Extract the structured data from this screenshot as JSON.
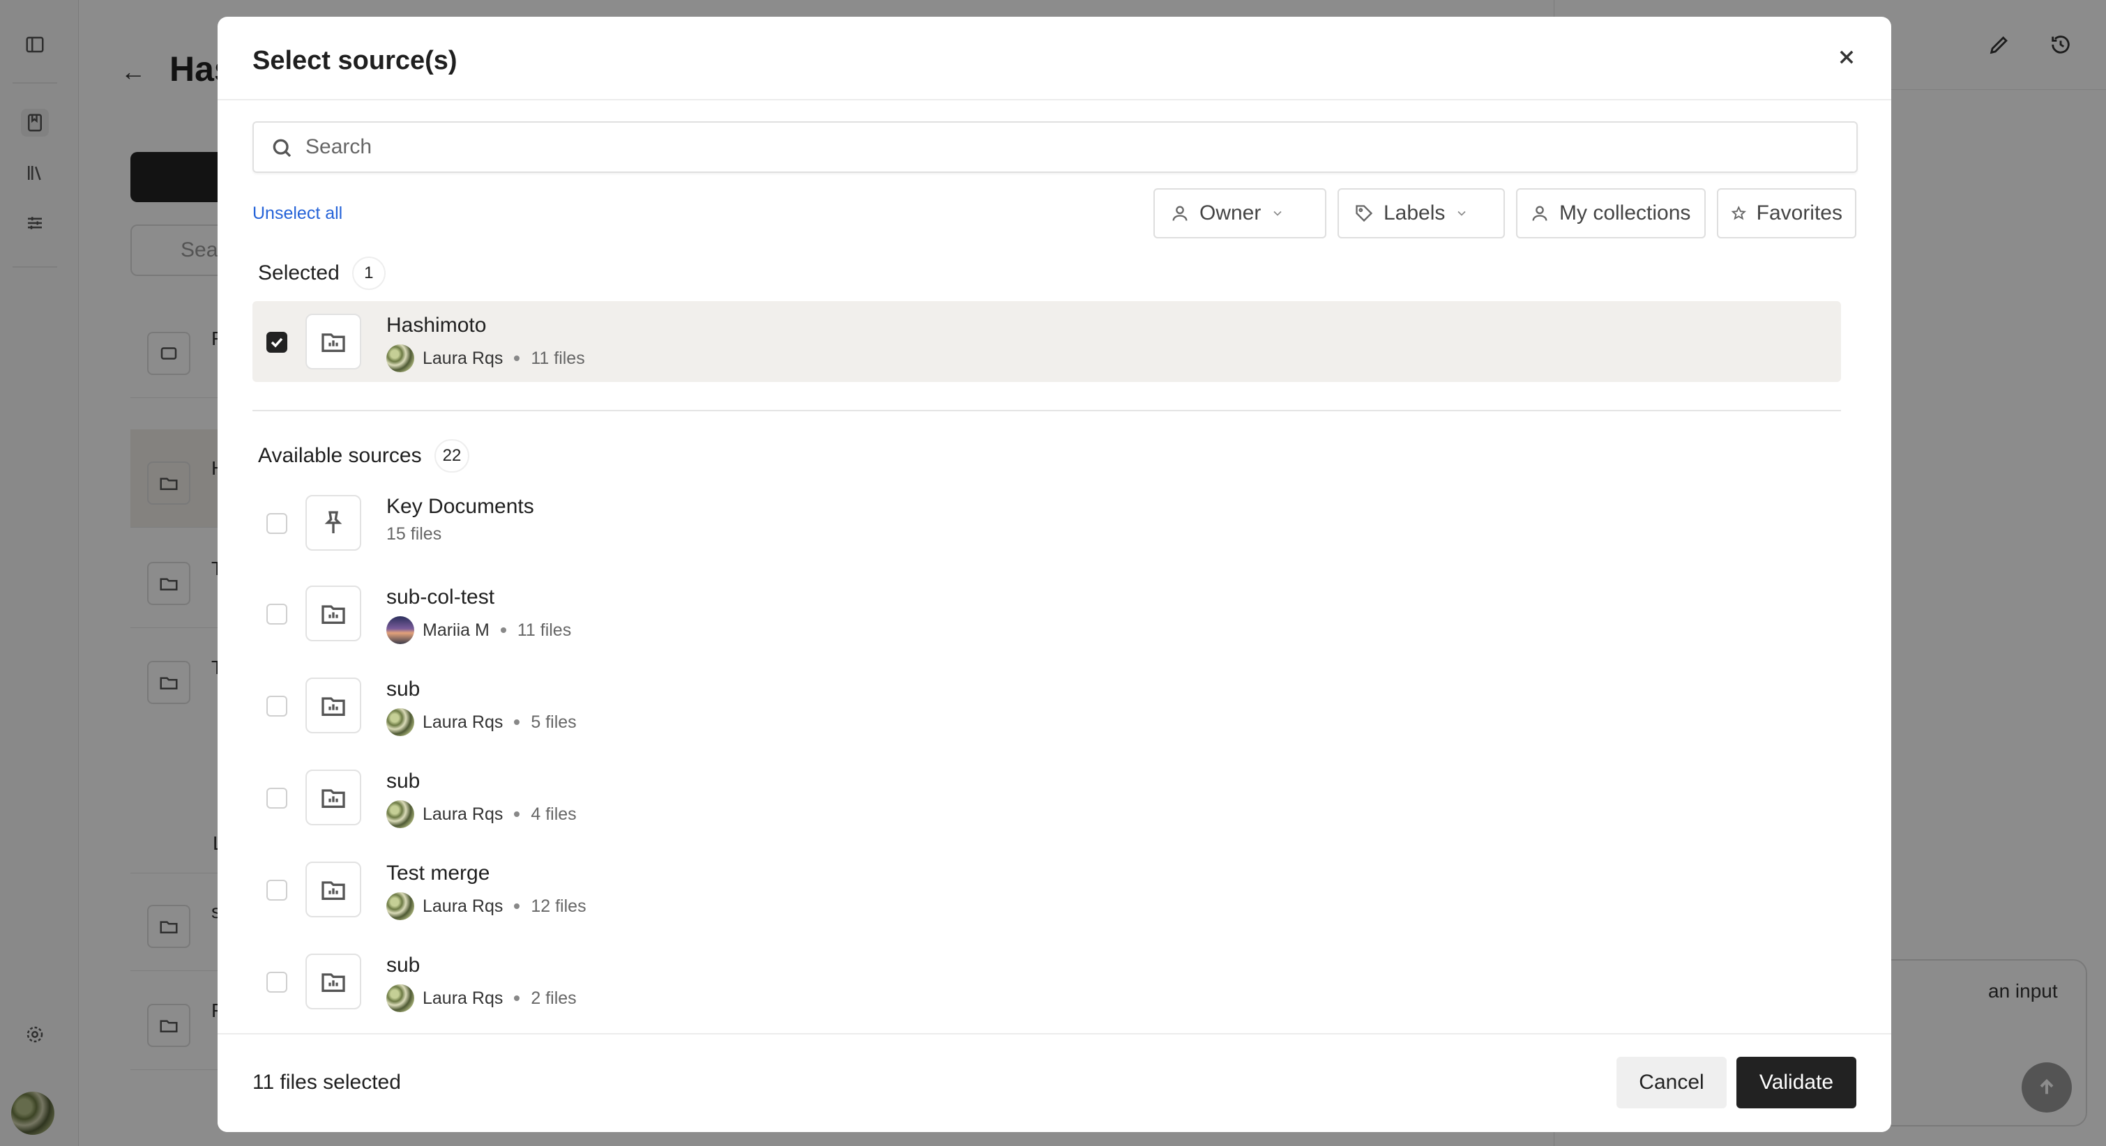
{
  "background": {
    "page_title": "Has",
    "search_placeholder": "Sea",
    "rows": [
      "F",
      "H",
      "T",
      "T",
      "s",
      "F"
    ],
    "row_sub": "L",
    "chat_input_text": "an input"
  },
  "modal": {
    "title": "Select source(s)",
    "search_placeholder": "Search",
    "unselect_all": "Unselect all",
    "filters": {
      "owner": "Owner",
      "labels": "Labels",
      "my_collections": "My collections",
      "favorites": "Favorites"
    },
    "selected": {
      "label": "Selected",
      "count": "1",
      "items": [
        {
          "name": "Hashimoto",
          "owner": "Laura Rqs",
          "files": "11 files",
          "icon": "folder-chart-icon",
          "checked": true
        }
      ]
    },
    "available": {
      "label": "Available sources",
      "count": "22",
      "items": [
        {
          "name": "Key Documents",
          "owner": "",
          "files": "15 files",
          "icon": "pin-icon",
          "checked": false
        },
        {
          "name": "sub-col-test",
          "owner": "Mariia M",
          "files": "11 files",
          "icon": "folder-chart-icon",
          "checked": false
        },
        {
          "name": "sub",
          "owner": "Laura Rqs",
          "files": "5 files",
          "icon": "folder-chart-icon",
          "checked": false
        },
        {
          "name": "sub",
          "owner": "Laura Rqs",
          "files": "4 files",
          "icon": "folder-chart-icon",
          "checked": false
        },
        {
          "name": "Test merge",
          "owner": "Laura Rqs",
          "files": "12 files",
          "icon": "folder-chart-icon",
          "checked": false
        },
        {
          "name": "sub",
          "owner": "Laura Rqs",
          "files": "2 files",
          "icon": "folder-chart-icon",
          "checked": false
        }
      ]
    },
    "footer": {
      "files_selected": "11 files selected",
      "cancel": "Cancel",
      "validate": "Validate"
    }
  }
}
